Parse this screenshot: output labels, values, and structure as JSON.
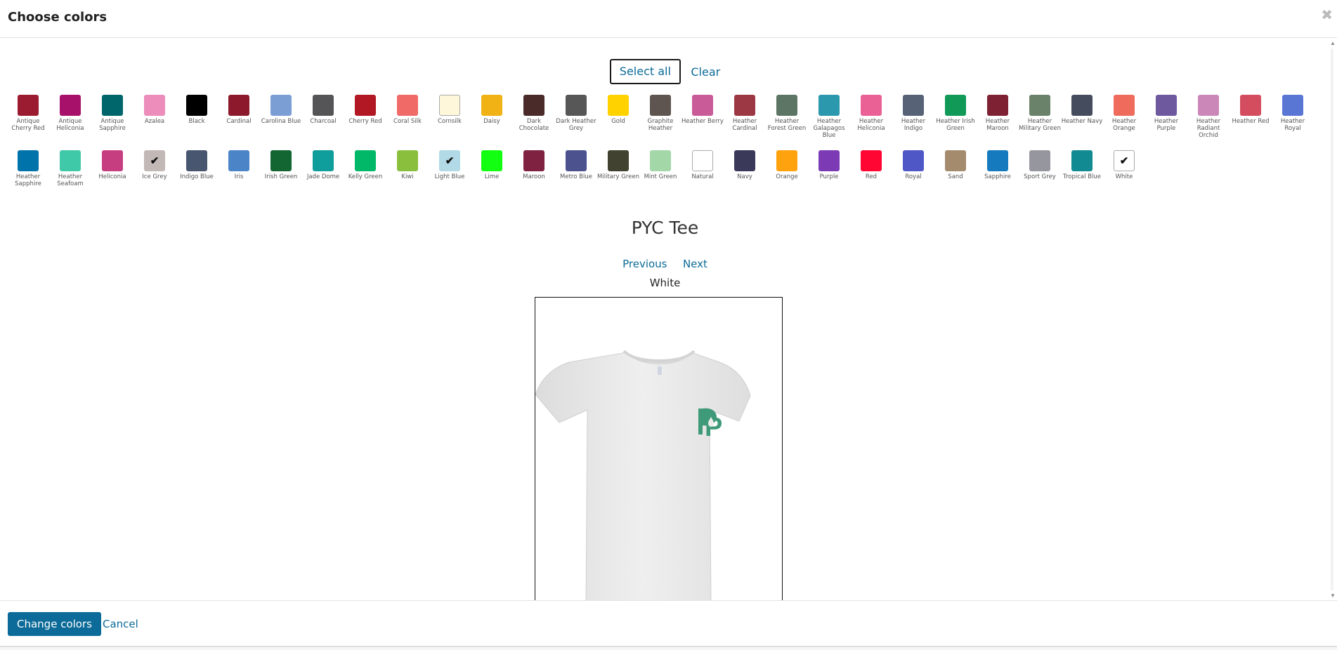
{
  "dialog": {
    "title": "Choose colors",
    "close_icon": "close-icon"
  },
  "selection": {
    "select_all": "Select all",
    "clear": "Clear"
  },
  "swatches": [
    {
      "name": "Antique Cherry Red",
      "color": "#9b1b30",
      "checked": false
    },
    {
      "name": "Antique Heliconia",
      "color": "#a8116a",
      "checked": false
    },
    {
      "name": "Antique Sapphire",
      "color": "#00666b",
      "checked": false
    },
    {
      "name": "Azalea",
      "color": "#ec8dbb",
      "checked": false
    },
    {
      "name": "Black",
      "color": "#000000",
      "checked": false
    },
    {
      "name": "Cardinal",
      "color": "#8c1a2c",
      "checked": false
    },
    {
      "name": "Carolina Blue",
      "color": "#7b9ed4",
      "checked": false
    },
    {
      "name": "Charcoal",
      "color": "#555557",
      "checked": false
    },
    {
      "name": "Cherry Red",
      "color": "#b21823",
      "checked": false
    },
    {
      "name": "Coral Silk",
      "color": "#f06b68",
      "checked": false
    },
    {
      "name": "Cornsilk",
      "color": "#fff7da",
      "checked": false
    },
    {
      "name": "Daisy",
      "color": "#f0b214",
      "checked": false
    },
    {
      "name": "Dark Chocolate",
      "color": "#4a2b2a",
      "checked": false
    },
    {
      "name": "Dark Heather Grey",
      "color": "#575757",
      "checked": false
    },
    {
      "name": "Gold",
      "color": "#ffd200",
      "checked": false
    },
    {
      "name": "Graphite Heather",
      "color": "#5e5450",
      "checked": false
    },
    {
      "name": "Heather Berry",
      "color": "#c95c98",
      "checked": false
    },
    {
      "name": "Heather Cardinal",
      "color": "#9b3844",
      "checked": false
    },
    {
      "name": "Heather Forest Green",
      "color": "#5d7564",
      "checked": false
    },
    {
      "name": "Heather Galapagos Blue",
      "color": "#2c98ad",
      "checked": false
    },
    {
      "name": "Heather Heliconia",
      "color": "#ea6196",
      "checked": false
    },
    {
      "name": "Heather Indigo",
      "color": "#576276",
      "checked": false
    },
    {
      "name": "Heather Irish Green",
      "color": "#109957",
      "checked": false
    },
    {
      "name": "Heather Maroon",
      "color": "#7d2133",
      "checked": false
    },
    {
      "name": "Heather Military Green",
      "color": "#6a826a",
      "checked": false
    },
    {
      "name": "Heather Navy",
      "color": "#454c5e",
      "checked": false
    },
    {
      "name": "Heather Orange",
      "color": "#ef6b5b",
      "checked": false
    },
    {
      "name": "Heather Purple",
      "color": "#6e589e",
      "checked": false
    },
    {
      "name": "Heather Radiant Orchid",
      "color": "#cc87b9",
      "checked": false
    },
    {
      "name": "Heather Red",
      "color": "#d34d5e",
      "checked": false
    },
    {
      "name": "Heather Royal",
      "color": "#5a76d4",
      "checked": false
    },
    {
      "name": "Heather Sapphire",
      "color": "#0073aa",
      "checked": false
    },
    {
      "name": "Heather Seafoam",
      "color": "#40c9a9",
      "checked": false
    },
    {
      "name": "Heliconia",
      "color": "#c63e80",
      "checked": false
    },
    {
      "name": "Ice Grey",
      "color": "#c2b8b6",
      "checked": true
    },
    {
      "name": "Indigo Blue",
      "color": "#485670",
      "checked": false
    },
    {
      "name": "Iris",
      "color": "#4b85c8",
      "checked": false
    },
    {
      "name": "Irish Green",
      "color": "#136532",
      "checked": false
    },
    {
      "name": "Jade Dome",
      "color": "#0f9e9b",
      "checked": false
    },
    {
      "name": "Kelly Green",
      "color": "#00b867",
      "checked": false
    },
    {
      "name": "Kiwi",
      "color": "#8abf3e",
      "checked": false
    },
    {
      "name": "Light Blue",
      "color": "#b1d9e6",
      "checked": true
    },
    {
      "name": "Lime",
      "color": "#12ff12",
      "checked": false
    },
    {
      "name": "Maroon",
      "color": "#7f2140",
      "checked": false
    },
    {
      "name": "Metro Blue",
      "color": "#4c528e",
      "checked": false
    },
    {
      "name": "Military Green",
      "color": "#414230",
      "checked": false
    },
    {
      "name": "Mint Green",
      "color": "#a4d7a8",
      "checked": false
    },
    {
      "name": "Natural",
      "color": "#ffffff",
      "checked": false
    },
    {
      "name": "Navy",
      "color": "#3b3959",
      "checked": false
    },
    {
      "name": "Orange",
      "color": "#ffa20d",
      "checked": false
    },
    {
      "name": "Purple",
      "color": "#7c3bb5",
      "checked": false
    },
    {
      "name": "Red",
      "color": "#ff0633",
      "checked": false
    },
    {
      "name": "Royal",
      "color": "#4f57c6",
      "checked": false
    },
    {
      "name": "Sand",
      "color": "#a58b6d",
      "checked": false
    },
    {
      "name": "Sapphire",
      "color": "#157bbe",
      "checked": false
    },
    {
      "name": "Sport Grey",
      "color": "#96969e",
      "checked": false
    },
    {
      "name": "Tropical Blue",
      "color": "#118a92",
      "checked": false
    },
    {
      "name": "White",
      "color": "#ffffff",
      "checked": true
    }
  ],
  "product": {
    "title": "PYC Tee",
    "previous": "Previous",
    "next": "Next",
    "current_color": "White",
    "logo_letter": "P",
    "shirt_color": "#ececec",
    "logo_color": "#3f9a7a"
  },
  "footer": {
    "change_colors": "Change colors",
    "cancel": "Cancel"
  }
}
